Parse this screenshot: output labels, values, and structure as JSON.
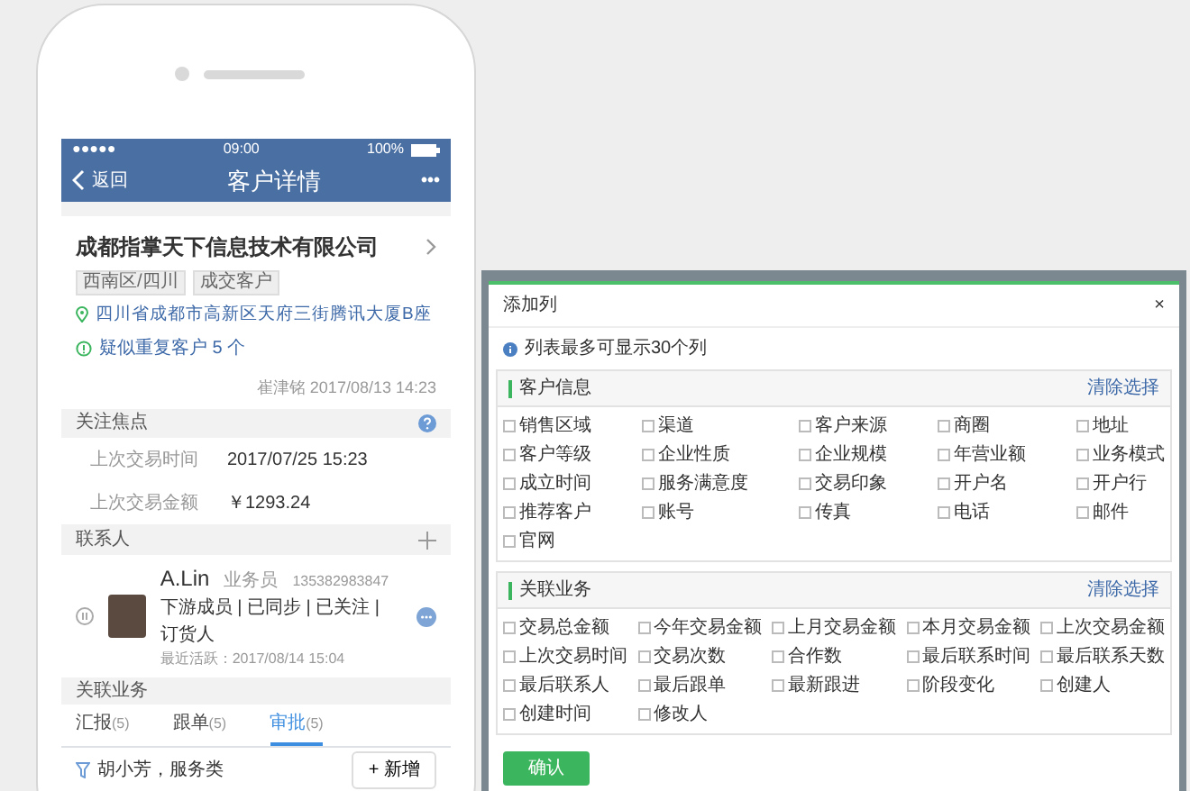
{
  "phone": {
    "status_bar": {
      "signal": "●●●●●",
      "time": "09:00",
      "battery": "100%"
    },
    "nav": {
      "back": "返回",
      "title": "客户详情",
      "more": "•••"
    },
    "company": {
      "name": "成都指掌天下信息技术有限公司",
      "tags": [
        "西南区/四川",
        "成交客户"
      ],
      "address": "四川省成都市高新区天府三街腾讯大厦B座",
      "duplicate": "疑似重复客户 5 个",
      "footer": "崔津铭 2017/08/13 14:23"
    },
    "focus": {
      "title": "关注焦点",
      "rows": [
        {
          "label": "上次交易时间",
          "value": "2017/07/25 15:23"
        },
        {
          "label": "上次交易金额",
          "value": "￥1293.24"
        }
      ]
    },
    "contacts": {
      "title": "联系人",
      "items": [
        {
          "name": "A.Lin",
          "role": "业务员",
          "phone": "135382983847",
          "tags": "下游成员 | 已同步 | 已关注 | 订货人",
          "last_active": "最近活跃：2017/08/14 15:04"
        }
      ]
    },
    "related": {
      "title": "关联业务",
      "tabs": [
        {
          "label": "汇报",
          "count": "(5)",
          "selected": false
        },
        {
          "label": "跟单",
          "count": "(5)",
          "selected": false
        },
        {
          "label": "审批",
          "count": "(5)",
          "selected": true
        }
      ],
      "filter": "胡小芳，服务类",
      "add_button": "+ 新增"
    }
  },
  "dialog": {
    "title": "添加列",
    "close": "×",
    "info": "列表最多可显示30个列",
    "sections": [
      {
        "title": "客户信息",
        "clear": "清除选择",
        "options": [
          {
            "label": "销售区域",
            "checked": false
          },
          {
            "label": "渠道",
            "checked": false
          },
          {
            "label": "客户来源",
            "checked": false
          },
          {
            "label": "商圈",
            "checked": false
          },
          {
            "label": "地址",
            "checked": false
          },
          {
            "label": "客户等级",
            "checked": false
          },
          {
            "label": "企业性质",
            "checked": false
          },
          {
            "label": "企业规模",
            "checked": false
          },
          {
            "label": "年营业额",
            "checked": false
          },
          {
            "label": "业务模式",
            "checked": false
          },
          {
            "label": "成立时间",
            "checked": false
          },
          {
            "label": "服务满意度",
            "checked": false
          },
          {
            "label": "交易印象",
            "checked": false
          },
          {
            "label": "开户名",
            "checked": false
          },
          {
            "label": "开户行",
            "checked": false
          },
          {
            "label": "推荐客户",
            "checked": false
          },
          {
            "label": "账号",
            "checked": false
          },
          {
            "label": "传真",
            "checked": false
          },
          {
            "label": "电话",
            "checked": false
          },
          {
            "label": "邮件",
            "checked": false
          },
          {
            "label": "官网",
            "checked": false
          }
        ]
      },
      {
        "title": "关联业务",
        "clear": "清除选择",
        "options": [
          {
            "label": "交易总金额",
            "checked": false
          },
          {
            "label": "今年交易金额",
            "checked": false
          },
          {
            "label": "上月交易金额",
            "checked": false
          },
          {
            "label": "本月交易金额",
            "checked": false
          },
          {
            "label": "上次交易金额",
            "checked": false
          },
          {
            "label": "上次交易时间",
            "checked": false
          },
          {
            "label": "交易次数",
            "checked": false
          },
          {
            "label": "合作数",
            "checked": false
          },
          {
            "label": "最后联系时间",
            "checked": false
          },
          {
            "label": "最后联系天数",
            "checked": false
          },
          {
            "label": "最后联系人",
            "checked": false
          },
          {
            "label": "最后跟单",
            "checked": false
          },
          {
            "label": "最新跟进",
            "checked": false
          },
          {
            "label": "阶段变化",
            "checked": false
          },
          {
            "label": "创建人",
            "checked": false
          },
          {
            "label": "创建时间",
            "checked": false
          },
          {
            "label": "修改人",
            "checked": false
          }
        ]
      }
    ],
    "confirm": "确认"
  }
}
